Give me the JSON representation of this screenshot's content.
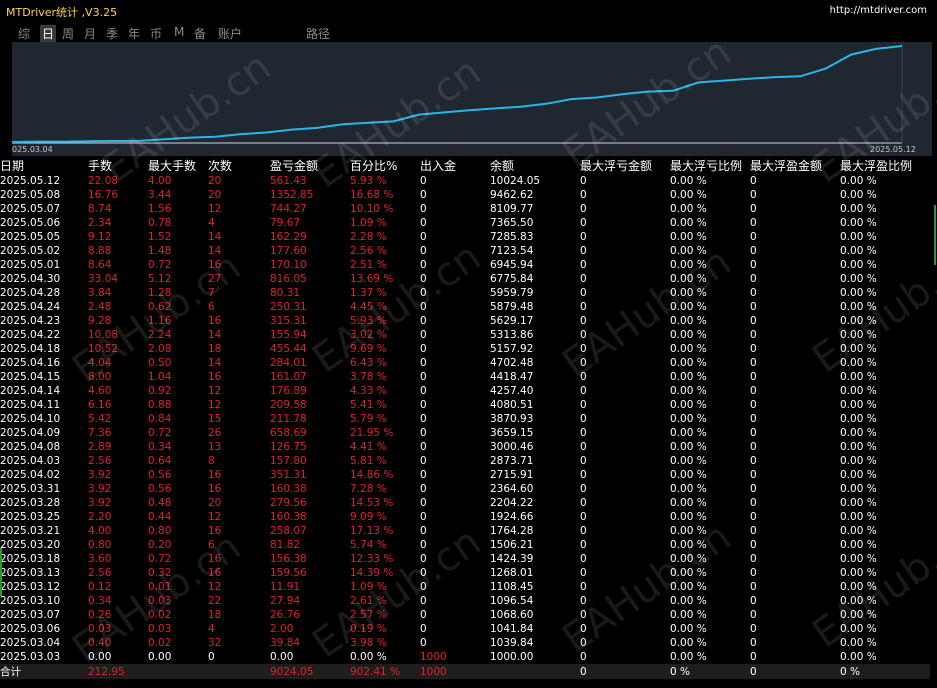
{
  "app": {
    "title": "MTDriver统计 ,V3.25",
    "url": "http://mtdriver.com"
  },
  "tabs": [
    {
      "label": "综"
    },
    {
      "label": "日",
      "active": true
    },
    {
      "label": "周"
    },
    {
      "label": "月"
    },
    {
      "label": "季"
    },
    {
      "label": "年"
    },
    {
      "label": "币"
    },
    {
      "label": "M"
    },
    {
      "label": "备"
    },
    {
      "label": "账户"
    },
    {
      "label": "路径"
    }
  ],
  "chart": {
    "start_label": "025.03.04",
    "end_label": "2025.05.12",
    "line_color": "#29b6e8"
  },
  "chart_data": {
    "type": "line",
    "x": [
      "2025.03.03",
      "2025.03.04",
      "2025.03.06",
      "2025.03.07",
      "2025.03.10",
      "2025.03.12",
      "2025.03.13",
      "2025.03.18",
      "2025.03.20",
      "2025.03.21",
      "2025.03.25",
      "2025.03.27",
      "2025.03.28",
      "2025.03.31",
      "2025.04.02",
      "2025.04.03",
      "2025.04.08",
      "2025.04.09",
      "2025.04.10",
      "2025.04.11",
      "2025.04.14",
      "2025.04.15",
      "2025.04.16",
      "2025.04.18",
      "2025.04.22",
      "2025.04.23",
      "2025.04.24",
      "2025.04.28",
      "2025.04.30",
      "2025.05.01",
      "2025.05.02",
      "2025.05.05",
      "2025.05.06",
      "2025.05.07",
      "2025.05.08",
      "2025.05.12"
    ],
    "y": [
      1000.0,
      1039.84,
      1041.84,
      1068.6,
      1096.54,
      1108.45,
      1268.01,
      1424.39,
      1506.21,
      1764.28,
      1924.66,
      2204.22,
      2364.6,
      2715.91,
      2873.71,
      3000.46,
      3659.15,
      3870.93,
      4080.51,
      4257.4,
      4418.47,
      4702.48,
      5157.92,
      5313.86,
      5629.17,
      5879.48,
      5959.79,
      6775.84,
      6945.94,
      7123.54,
      7285.83,
      7365.5,
      8109.77,
      9462.62,
      10024.05,
      10300.0
    ]
  },
  "columns": [
    "日期",
    "手数",
    "最大手数",
    "次数",
    "盈亏金额",
    "百分比%",
    "出入金",
    "余额",
    "最大浮亏金额",
    "最大浮亏比例",
    "最大浮盈金额",
    "最大浮盈比例"
  ],
  "rows": [
    [
      "2025.05.12",
      "22.08",
      "4.00",
      "20",
      "561.43",
      "5.93 %",
      "0",
      "10024.05",
      "0",
      "0.00 %",
      "0",
      "0.00 %"
    ],
    [
      "2025.05.08",
      "16.76",
      "3.44",
      "20",
      "1352.85",
      "16.68 %",
      "0",
      "9462.62",
      "0",
      "0.00 %",
      "0",
      "0.00 %"
    ],
    [
      "2025.05.07",
      "8.74",
      "1.56",
      "12",
      "744.27",
      "10.10 %",
      "0",
      "8109.77",
      "0",
      "0.00 %",
      "0",
      "0.00 %"
    ],
    [
      "2025.05.06",
      "2.34",
      "0.78",
      "4",
      "79.67",
      "1.09 %",
      "0",
      "7365.50",
      "0",
      "0.00 %",
      "0",
      "0.00 %"
    ],
    [
      "2025.05.05",
      "9.12",
      "1.52",
      "14",
      "162.29",
      "2.28 %",
      "0",
      "7285.83",
      "0",
      "0.00 %",
      "0",
      "0.00 %"
    ],
    [
      "2025.05.02",
      "8.88",
      "1.48",
      "14",
      "177.60",
      "2.56 %",
      "0",
      "7123.54",
      "0",
      "0.00 %",
      "0",
      "0.00 %"
    ],
    [
      "2025.05.01",
      "8.64",
      "0.72",
      "16",
      "170.10",
      "2.51 %",
      "0",
      "6945.94",
      "0",
      "0.00 %",
      "0",
      "0.00 %"
    ],
    [
      "2025.04.30",
      "33.04",
      "5.12",
      "27",
      "816.05",
      "13.69 %",
      "0",
      "6775.84",
      "0",
      "0.00 %",
      "0",
      "0.00 %"
    ],
    [
      "2025.04.28",
      "3.84",
      "1.28",
      "7",
      "80.31",
      "1.37 %",
      "0",
      "5959.79",
      "0",
      "0.00 %",
      "0",
      "0.00 %"
    ],
    [
      "2025.04.24",
      "2.48",
      "0.62",
      "6",
      "250.31",
      "4.45 %",
      "0",
      "5879.48",
      "0",
      "0.00 %",
      "0",
      "0.00 %"
    ],
    [
      "2025.04.23",
      "9.28",
      "1.16",
      "16",
      "315.31",
      "5.93 %",
      "0",
      "5629.17",
      "0",
      "0.00 %",
      "0",
      "0.00 %"
    ],
    [
      "2025.04.22",
      "10.08",
      "2.24",
      "14",
      "155.94",
      "3.02 %",
      "0",
      "5313.86",
      "0",
      "0.00 %",
      "0",
      "0.00 %"
    ],
    [
      "2025.04.18",
      "10.52",
      "2.08",
      "18",
      "455.44",
      "9.69 %",
      "0",
      "5157.92",
      "0",
      "0.00 %",
      "0",
      "0.00 %"
    ],
    [
      "2025.04.16",
      "4.04",
      "0.50",
      "14",
      "284.01",
      "6.43 %",
      "0",
      "4702.48",
      "0",
      "0.00 %",
      "0",
      "0.00 %"
    ],
    [
      "2025.04.15",
      "8.00",
      "1.04",
      "16",
      "161.07",
      "3.78 %",
      "0",
      "4418.47",
      "0",
      "0.00 %",
      "0",
      "0.00 %"
    ],
    [
      "2025.04.14",
      "4.60",
      "0.92",
      "12",
      "176.89",
      "4.33 %",
      "0",
      "4257.40",
      "0",
      "0.00 %",
      "0",
      "0.00 %"
    ],
    [
      "2025.04.11",
      "6.16",
      "0.88",
      "12",
      "209.58",
      "5.41 %",
      "0",
      "4080.51",
      "0",
      "0.00 %",
      "0",
      "0.00 %"
    ],
    [
      "2025.04.10",
      "5.42",
      "0.84",
      "15",
      "211.78",
      "5.79 %",
      "0",
      "3870.93",
      "0",
      "0.00 %",
      "0",
      "0.00 %"
    ],
    [
      "2025.04.09",
      "7.36",
      "0.72",
      "26",
      "658.69",
      "21.95 %",
      "0",
      "3659.15",
      "0",
      "0.00 %",
      "0",
      "0.00 %"
    ],
    [
      "2025.04.08",
      "2.89",
      "0.34",
      "13",
      "126.75",
      "4.41 %",
      "0",
      "3000.46",
      "0",
      "0.00 %",
      "0",
      "0.00 %"
    ],
    [
      "2025.04.03",
      "2.56",
      "0.64",
      "8",
      "157.80",
      "5.81 %",
      "0",
      "2873.71",
      "0",
      "0.00 %",
      "0",
      "0.00 %"
    ],
    [
      "2025.04.02",
      "3.92",
      "0.56",
      "16",
      "351.31",
      "14.86 %",
      "0",
      "2715.91",
      "0",
      "0.00 %",
      "0",
      "0.00 %"
    ],
    [
      "2025.03.31",
      "3.92",
      "0.56",
      "16",
      "160.38",
      "7.28 %",
      "0",
      "2364.60",
      "0",
      "0.00 %",
      "0",
      "0.00 %"
    ],
    [
      "2025.03.28",
      "3.92",
      "0.48",
      "20",
      "279.56",
      "14.53 %",
      "0",
      "2204.22",
      "0",
      "0.00 %",
      "0",
      "0.00 %"
    ],
    [
      "2025.03.25",
      "2.20",
      "0.44",
      "12",
      "160.38",
      "9.09 %",
      "0",
      "1924.66",
      "0",
      "0.00 %",
      "0",
      "0.00 %"
    ],
    [
      "2025.03.21",
      "4.00",
      "0.80",
      "16",
      "258.07",
      "17.13 %",
      "0",
      "1764.28",
      "0",
      "0.00 %",
      "0",
      "0.00 %"
    ],
    [
      "2025.03.20",
      "0.80",
      "0.20",
      "6",
      "81.82",
      "5.74 %",
      "0",
      "1506.21",
      "0",
      "0.00 %",
      "0",
      "0.00 %"
    ],
    [
      "2025.03.18",
      "3.60",
      "0.72",
      "16",
      "156.38",
      "12.33 %",
      "0",
      "1424.39",
      "0",
      "0.00 %",
      "0",
      "0.00 %"
    ],
    [
      "2025.03.13",
      "2.56",
      "0.32",
      "16",
      "159.56",
      "14.39 %",
      "0",
      "1268.01",
      "0",
      "0.00 %",
      "0",
      "0.00 %"
    ],
    [
      "2025.03.12",
      "0.12",
      "0.01",
      "12",
      "11.91",
      "1.09 %",
      "0",
      "1108.45",
      "0",
      "0.00 %",
      "0",
      "0.00 %"
    ],
    [
      "2025.03.10",
      "0.34",
      "0.03",
      "22",
      "27.94",
      "2.61 %",
      "0",
      "1096.54",
      "0",
      "0.00 %",
      "0",
      "0.00 %"
    ],
    [
      "2025.03.07",
      "0.26",
      "0.02",
      "18",
      "26.76",
      "2.57 %",
      "0",
      "1068.60",
      "0",
      "0.00 %",
      "0",
      "0.00 %"
    ],
    [
      "2025.03.06",
      "0.03",
      "0.03",
      "4",
      "2.00",
      "0.19 %",
      "0",
      "1041.84",
      "0",
      "0.00 %",
      "0",
      "0.00 %"
    ],
    [
      "2025.03.04",
      "0.40",
      "0.02",
      "32",
      "39.84",
      "3.98 %",
      "0",
      "1039.84",
      "0",
      "0.00 %",
      "0",
      "0.00 %"
    ],
    [
      "2025.03.03",
      "0.00",
      "0.00",
      "0",
      "0.00",
      "0.00 %",
      "1000",
      "1000.00",
      "0",
      "0.00 %",
      "0",
      "0.00 %"
    ]
  ],
  "total": [
    "合计",
    "212.95",
    "",
    "",
    "9024.05",
    "902.41 %",
    "1000",
    "",
    "0",
    "0 %",
    "0",
    "0 %"
  ],
  "watermark": "EAHub.cn",
  "colors": {
    "profit_red": "#e0222a",
    "title_gold": "#ffd34e",
    "chart_bg": "#1f2730"
  }
}
